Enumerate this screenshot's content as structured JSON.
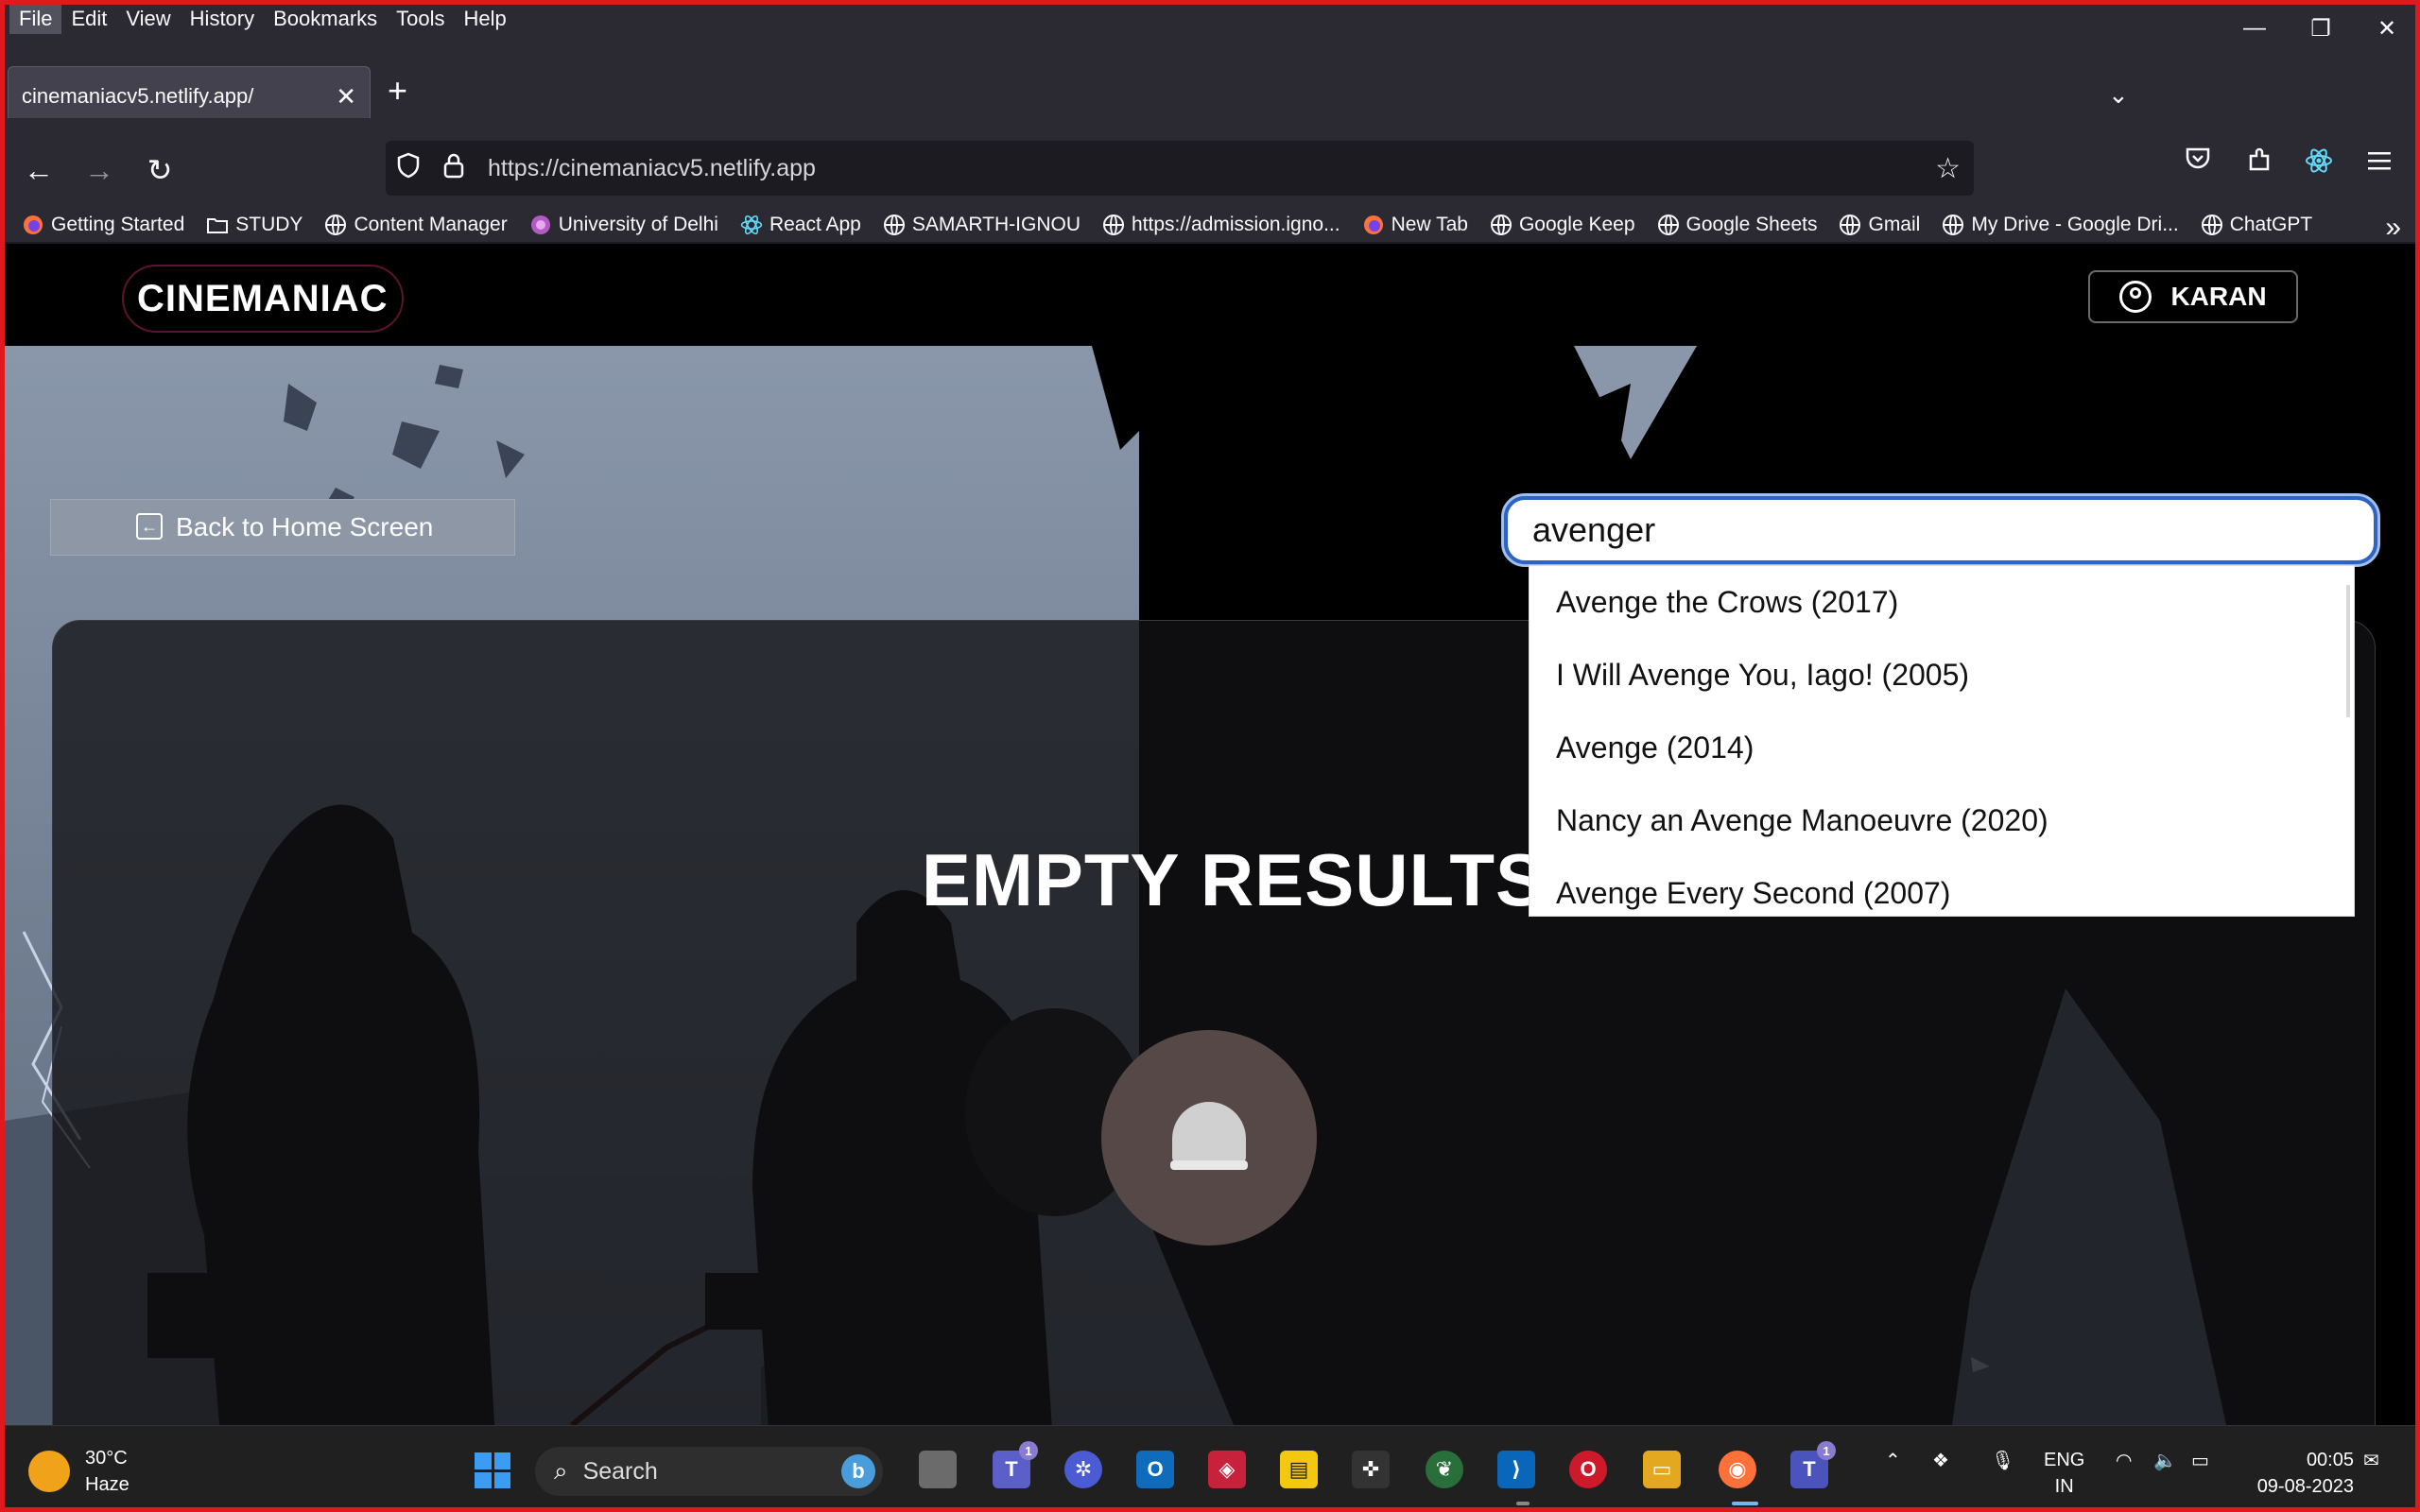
{
  "menu": [
    "File",
    "Edit",
    "View",
    "History",
    "Bookmarks",
    "Tools",
    "Help"
  ],
  "window_controls": {
    "minimize": "—",
    "restore": "❐",
    "close": "✕"
  },
  "tab": {
    "title": "cinemaniacv5.netlify.app/",
    "close": "✕"
  },
  "new_tab": "+",
  "tab_list": "⌄",
  "nav": {
    "back": "←",
    "forward": "→",
    "reload": "↻"
  },
  "url": {
    "text": "https://cinemaniacv5.netlify.app",
    "star": "☆"
  },
  "bookmarks": [
    {
      "label": "Getting Started",
      "icon": "firefox-icon"
    },
    {
      "label": "STUDY",
      "icon": "folder-icon"
    },
    {
      "label": "Content Manager",
      "icon": "globe-icon"
    },
    {
      "label": "University of Delhi",
      "icon": "du-logo-icon"
    },
    {
      "label": "React App",
      "icon": "react-icon"
    },
    {
      "label": "SAMARTH-IGNOU",
      "icon": "globe-icon"
    },
    {
      "label": "https://admission.igno...",
      "icon": "globe-icon"
    },
    {
      "label": "New Tab",
      "icon": "firefox-icon"
    },
    {
      "label": "Google Keep",
      "icon": "globe-icon"
    },
    {
      "label": "Google Sheets",
      "icon": "globe-icon"
    },
    {
      "label": "Gmail",
      "icon": "globe-icon"
    },
    {
      "label": "My Drive - Google Dri...",
      "icon": "globe-icon"
    },
    {
      "label": "ChatGPT",
      "icon": "globe-icon"
    }
  ],
  "bookmarks_more": "»",
  "site": {
    "logo": "CINEMANIAC",
    "user_name": "KARAN",
    "back_button": "Back to Home Screen",
    "empty_title": "EMPTY RESULTS",
    "search_value": "avenger",
    "suggestions": [
      "Avenge the Crows (2017)",
      "I Will Avenge You, Iago! (2005)",
      "Avenge (2014)",
      "Nancy an Avenge Manoeuvre (2020)",
      "Avenge Every Second (2007)"
    ]
  },
  "taskbar": {
    "weather_temp": "30°C",
    "weather_desc": "Haze",
    "search": "Search",
    "lang_1": "ENG",
    "lang_2": "IN",
    "time": "00:05",
    "date": "09-08-2023"
  },
  "colors": {
    "accent": "#2e63c4",
    "frame": "#e0191e",
    "browser_chrome": "#2b2a33"
  }
}
